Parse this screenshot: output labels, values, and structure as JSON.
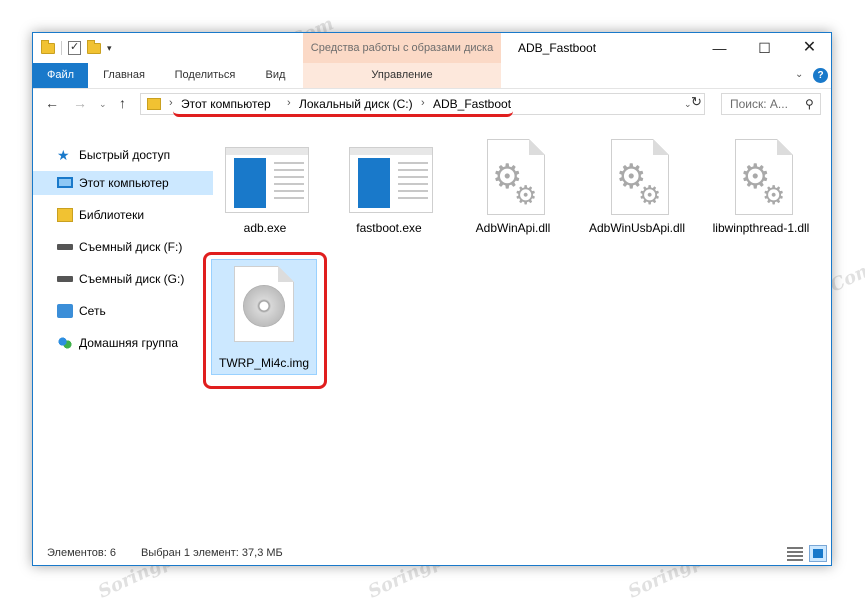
{
  "window": {
    "title": "ADB_Fastboot",
    "contextual_tab_group": "Средства работы с образами диска",
    "controls": {
      "minimize": "—",
      "maximize": "☐",
      "close": "✕"
    }
  },
  "ribbon": {
    "tabs": [
      "Файл",
      "Главная",
      "Поделиться",
      "Вид",
      "Управление"
    ],
    "help_glyph": "?"
  },
  "navigation": {
    "back": "←",
    "forward": "→",
    "up": "↑",
    "breadcrumb": [
      "Этот компьютер",
      "Локальный диск (C:)",
      "ADB_Fastboot"
    ],
    "separator": "›",
    "search_placeholder": "Поиск: А...",
    "refresh_glyph": "↻",
    "search_glyph": "⚲"
  },
  "sidebar": {
    "items": [
      {
        "label": "Быстрый доступ",
        "icon": "star-icon"
      },
      {
        "label": "Этот компьютер",
        "icon": "computer-icon",
        "selected": true
      },
      {
        "label": "Библиотеки",
        "icon": "library-icon"
      },
      {
        "label": "Съемный диск (F:)",
        "icon": "removable-drive-icon"
      },
      {
        "label": "Съемный диск (G:)",
        "icon": "removable-drive-icon"
      },
      {
        "label": "Сеть",
        "icon": "network-icon"
      },
      {
        "label": "Домашняя группа",
        "icon": "homegroup-icon"
      }
    ]
  },
  "files": [
    {
      "name": "adb.exe",
      "type": "exe"
    },
    {
      "name": "fastboot.exe",
      "type": "exe"
    },
    {
      "name": "AdbWinApi.dll",
      "type": "dll"
    },
    {
      "name": "AdbWinUsbApi.dll",
      "type": "dll"
    },
    {
      "name": "libwinpthread-1.dll",
      "type": "dll"
    },
    {
      "name": "TWRP_Mi4c.img",
      "type": "disc-image",
      "selected": true
    }
  ],
  "status": {
    "count": "Элементов: 6",
    "selection": "Выбран 1 элемент: 37,3 МБ"
  },
  "watermark": "Soringpcrepair.Com",
  "colors": {
    "accent": "#1979ca",
    "highlight": "#e01e1e",
    "selection": "#cce8ff",
    "context_tab": "#fbd9c6"
  }
}
